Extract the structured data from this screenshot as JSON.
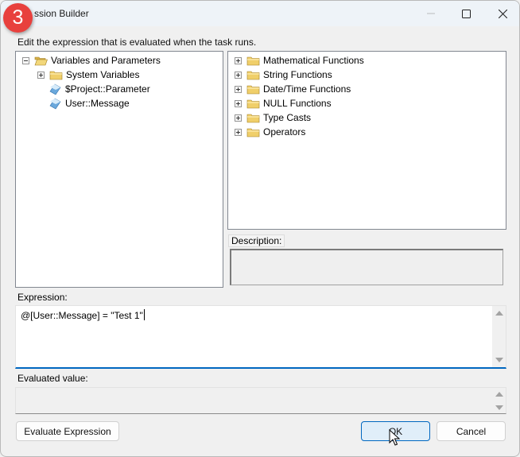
{
  "window": {
    "title": "Expression Builder",
    "visible_title_fragment": "ssion Builder",
    "controls": {
      "minimize": "minimize",
      "maximize": "maximize",
      "close": "close"
    }
  },
  "step_badge": {
    "number": "3",
    "color": "#e8403d"
  },
  "instruction": "Edit the expression that is evaluated when the task runs.",
  "variables_tree": {
    "root": {
      "label": "Variables and Parameters",
      "expanded": true,
      "icon": "open-folder-icon"
    },
    "children": [
      {
        "label": "System Variables",
        "icon": "folder-icon",
        "expandable": true
      },
      {
        "label": "$Project::Parameter",
        "icon": "variable-icon"
      },
      {
        "label": "User::Message",
        "icon": "variable-icon"
      }
    ]
  },
  "functions_tree": {
    "items": [
      {
        "label": "Mathematical Functions"
      },
      {
        "label": "String Functions"
      },
      {
        "label": "Date/Time Functions"
      },
      {
        "label": "NULL Functions"
      },
      {
        "label": "Type Casts"
      },
      {
        "label": "Operators"
      }
    ]
  },
  "description": {
    "label": "Description:",
    "value": ""
  },
  "expression": {
    "label": "Expression:",
    "value": "@[User::Message] = \"Test 1\""
  },
  "evaluated": {
    "label": "Evaluated value:",
    "value": ""
  },
  "buttons": {
    "evaluate": "Evaluate Expression",
    "ok": "OK",
    "cancel": "Cancel"
  },
  "colors": {
    "accent": "#0067c0",
    "ok_button_bg": "#e0eef9"
  }
}
